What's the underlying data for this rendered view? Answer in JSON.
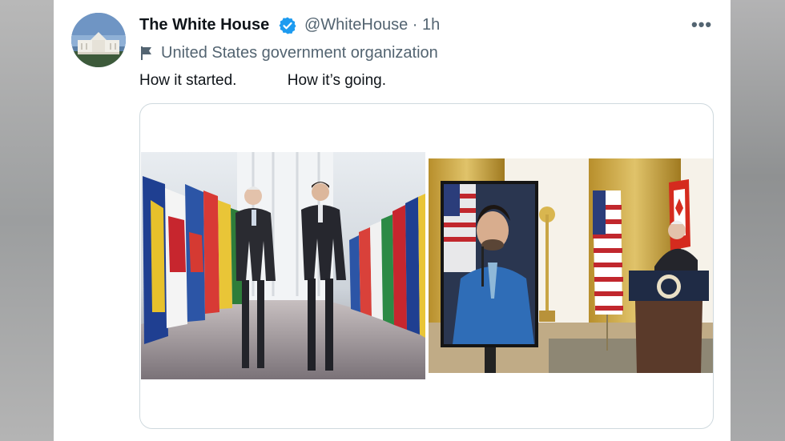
{
  "tweet": {
    "display_name": "The White House",
    "handle_time": "@WhiteHouse · 1h",
    "label": "United States government organization",
    "text": "How it started.            How it’s going."
  },
  "icons": {
    "verified": "verified-badge-icon",
    "flag": "flag-icon",
    "more": "more-options-icon"
  },
  "more_glyph": "•••",
  "colors": {
    "verified": "#1d9bf0",
    "secondary_text": "#536471",
    "primary_text": "#0f1419",
    "media_border": "#cfd9de"
  }
}
